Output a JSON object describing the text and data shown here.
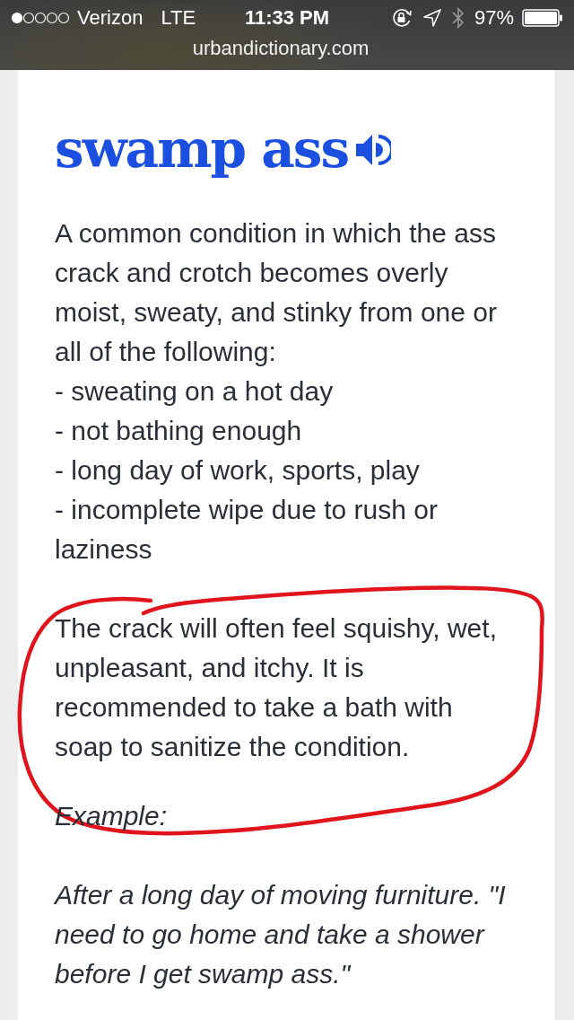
{
  "status_bar": {
    "carrier": "Verizon",
    "network": "LTE",
    "time": "11:33 PM",
    "battery": "97%"
  },
  "address_bar": {
    "url": "urbandictionary.com"
  },
  "entry": {
    "word": "swamp ass",
    "definition": [
      {
        "lines": [
          "A common condition in which the ass crack and crotch becomes overly moist, sweaty, and stinky from one or all of the following:",
          "- sweating on a hot day",
          "- not bathing enough",
          "- long day of work, sports, play",
          "- incomplete wipe due to rush or laziness"
        ],
        "circled": false
      },
      {
        "lines": [
          "The crack will often feel squishy, wet, unpleasant, and itchy. It is recommended to take a bath with soap to sanitize the condition."
        ],
        "circled": true
      }
    ],
    "example_label": "Example:",
    "example": "After a long day of moving furniture. \"I need to go home and take a shower before I get swamp ass.\""
  }
}
